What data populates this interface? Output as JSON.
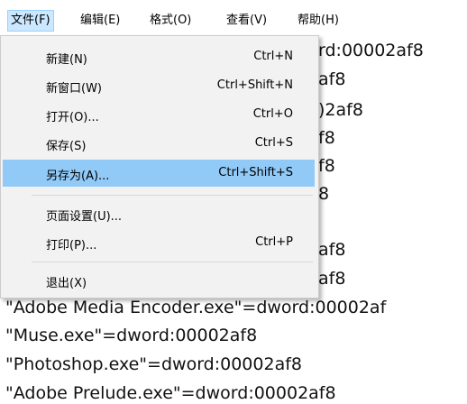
{
  "menubar": {
    "items": [
      {
        "label": "文件(F)"
      },
      {
        "label": "编辑(E)"
      },
      {
        "label": "格式(O)"
      },
      {
        "label": "查看(V)"
      },
      {
        "label": "帮助(H)"
      }
    ]
  },
  "editor": {
    "partial_lines": [
      "rd:00002af8",
      "af8",
      ")2af8",
      "f8",
      "f8",
      "8",
      "af8",
      "af8"
    ],
    "full_lines": [
      "\"Adobe Media Encoder.exe\"=dword:00002af",
      "\"Muse.exe\"=dword:00002af8",
      "\"Photoshop.exe\"=dword:00002af8",
      "\"Adobe Prelude.exe\"=dword:00002af8"
    ]
  },
  "file_menu": {
    "items": [
      {
        "label": "新建(N)",
        "shortcut": "Ctrl+N"
      },
      {
        "label": "新窗口(W)",
        "shortcut": "Ctrl+Shift+N"
      },
      {
        "label": "打开(O)...",
        "shortcut": "Ctrl+O"
      },
      {
        "label": "保存(S)",
        "shortcut": "Ctrl+S"
      },
      {
        "label": "另存为(A)...",
        "shortcut": "Ctrl+Shift+S"
      },
      {
        "label": "页面设置(U)...",
        "shortcut": ""
      },
      {
        "label": "打印(P)...",
        "shortcut": "Ctrl+P"
      },
      {
        "label": "退出(X)",
        "shortcut": ""
      }
    ]
  },
  "colors": {
    "menu_bg": "#f2f2f2",
    "highlight": "#91c9f7",
    "active_menu": "#cce8ff"
  }
}
